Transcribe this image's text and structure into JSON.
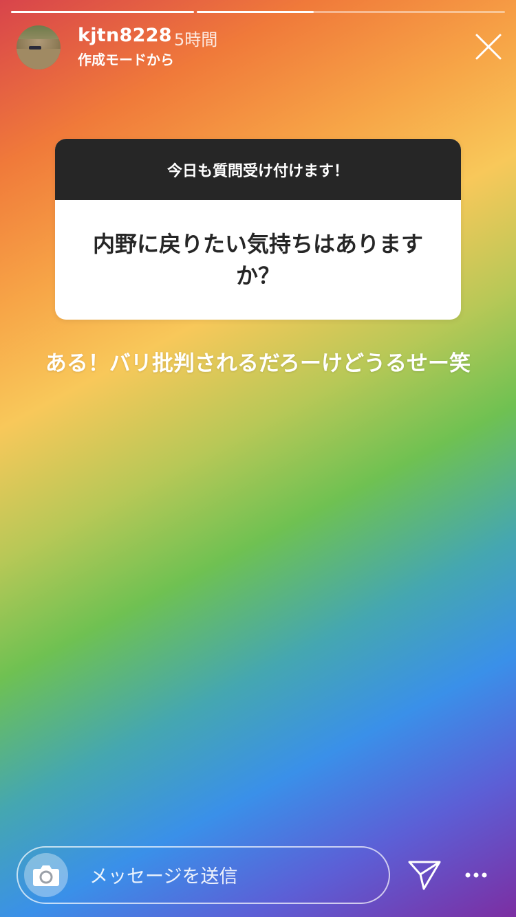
{
  "story": {
    "progress": [
      1,
      0.38
    ],
    "user": {
      "name": "kjtn8228",
      "time": "5時間",
      "subtitle": "作成モードから"
    },
    "question_card": {
      "header": "今日も質問受け付けます！",
      "question": "内野に戻りたい気持ちはありますか？"
    },
    "answer": "ある！バリ批判されるだろーけどうるせー笑"
  },
  "footer": {
    "message_placeholder": "メッセージを送信"
  },
  "icons": {
    "close": "close-icon",
    "camera": "camera-icon",
    "send": "send-icon",
    "more": "more-icon"
  },
  "colors": {
    "card_header": "#262626",
    "card_body": "#ffffff",
    "text": "#ffffff"
  }
}
